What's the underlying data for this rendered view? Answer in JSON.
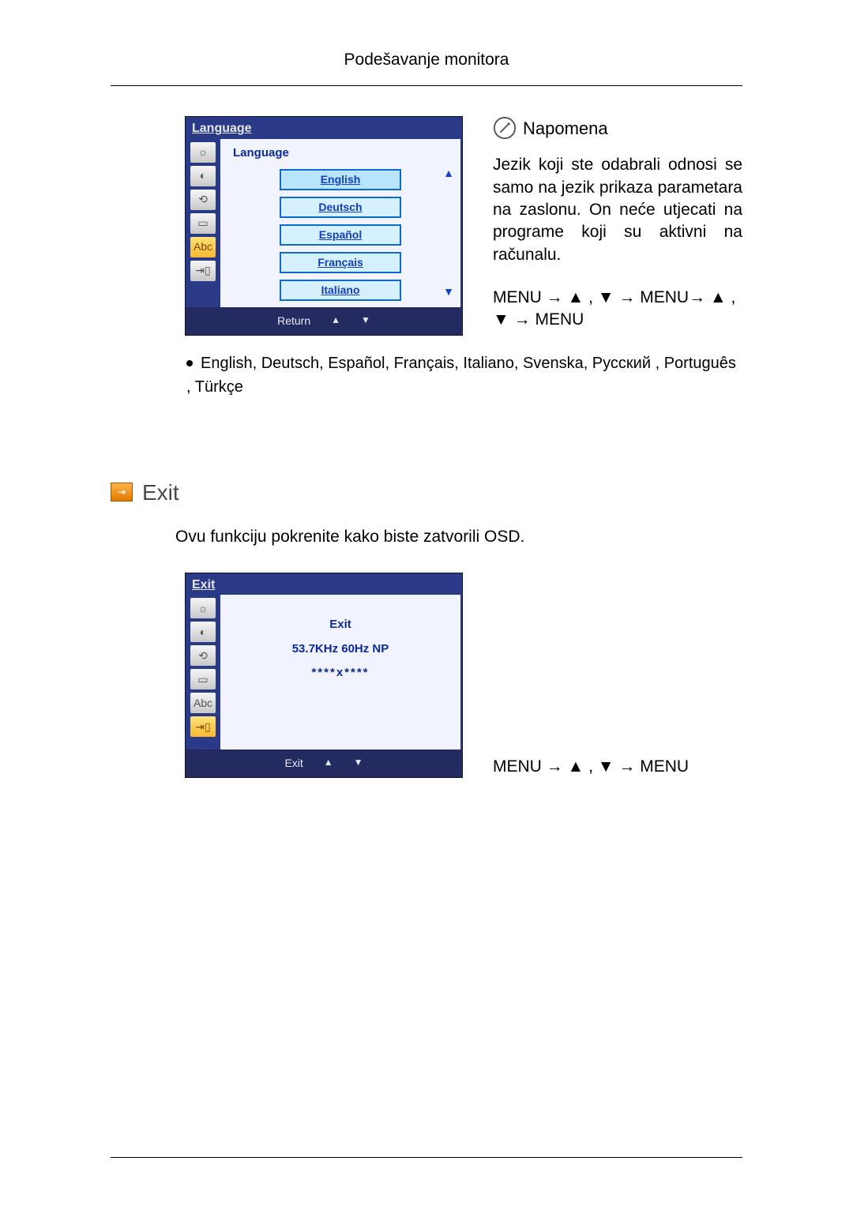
{
  "header": {
    "title": "Podešavanje monitora"
  },
  "lang_osd": {
    "title": "Language",
    "subtitle": "Language",
    "options": [
      "English",
      "Deutsch",
      "Español",
      "Français",
      "Italiano"
    ],
    "footer_label": "Return",
    "footer_up": "▲",
    "footer_dn": "▼"
  },
  "note": {
    "title": "Napomena",
    "body": "Jezik koji ste odabrali odnosi se samo na jezik prikaza parametara na zaslonu. On neće utjecati na programe koji su aktivni na računalu.",
    "nav": "MENU → ▲ , ▼ → MENU→ ▲ , ▼ → MENU"
  },
  "lang_line": "English, Deutsch, Español, Français,  Italiano, Svenska, Русский , Português , Türkçe",
  "exit": {
    "heading": "Exit",
    "desc": "Ovu funkciju pokrenite kako biste zatvorili OSD.",
    "osd_title": "Exit",
    "panel_title": "Exit",
    "panel_freq": "53.7KHz 60Hz NP",
    "panel_res": "****x****",
    "footer_label": "Exit",
    "footer_up": "▲",
    "footer_dn": "▼",
    "nav": "MENU → ▲ , ▼ → MENU"
  },
  "icons": {
    "tabs": [
      "☼",
      "◐",
      "⟲",
      "▭",
      "Abc",
      "⇥▯"
    ]
  }
}
